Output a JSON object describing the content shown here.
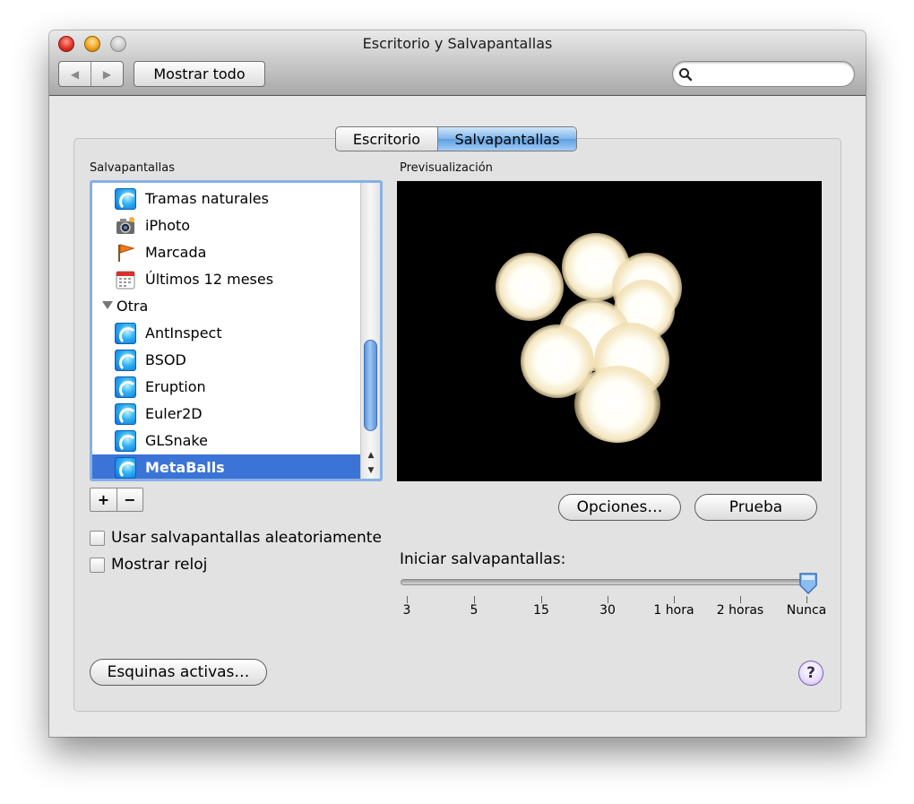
{
  "window": {
    "title": "Escritorio y Salvapantallas"
  },
  "toolbar": {
    "back_icon": "chevron-left-icon",
    "forward_icon": "chevron-right-icon",
    "show_all_label": "Mostrar todo",
    "search_placeholder": "",
    "search_icon": "magnifier-icon"
  },
  "tabs": [
    {
      "label": "Escritorio",
      "selected": false
    },
    {
      "label": "Salvapantallas",
      "selected": true
    }
  ],
  "list": {
    "header": "Salvapantallas",
    "items": [
      {
        "label": "Tramas naturales",
        "icon": "screensaver-icon"
      },
      {
        "label": "iPhoto",
        "icon": "iphoto-icon"
      },
      {
        "label": "Marcada",
        "icon": "flag-icon"
      },
      {
        "label": "Últimos 12 meses",
        "icon": "calendar-icon"
      },
      {
        "label": "Otra",
        "icon": "disclosure-triangle-icon",
        "group": true
      },
      {
        "label": "AntInspect",
        "icon": "screensaver-icon"
      },
      {
        "label": "BSOD",
        "icon": "screensaver-icon"
      },
      {
        "label": "Eruption",
        "icon": "screensaver-icon"
      },
      {
        "label": "Euler2D",
        "icon": "screensaver-icon"
      },
      {
        "label": "GLSnake",
        "icon": "screensaver-icon"
      },
      {
        "label": "MetaBalls",
        "icon": "screensaver-icon",
        "selected": true
      }
    ],
    "add_label": "+",
    "remove_label": "−"
  },
  "options": {
    "random_label": "Usar salvapantallas aleatoriamente",
    "random_checked": false,
    "clock_label": "Mostrar reloj",
    "clock_checked": false
  },
  "preview": {
    "header": "Previsualización",
    "options_button": "Opciones…",
    "test_button": "Prueba"
  },
  "start": {
    "label": "Iniciar salvapantallas:",
    "ticks": [
      "3",
      "5",
      "15",
      "30",
      "1 hora",
      "2 horas",
      "Nunca"
    ],
    "selected": "Nunca"
  },
  "hot_corners_button": "Esquinas activas…",
  "help_label": "?",
  "colors": {
    "selection": "#3b74d6",
    "accent": "#5d9fe2"
  }
}
